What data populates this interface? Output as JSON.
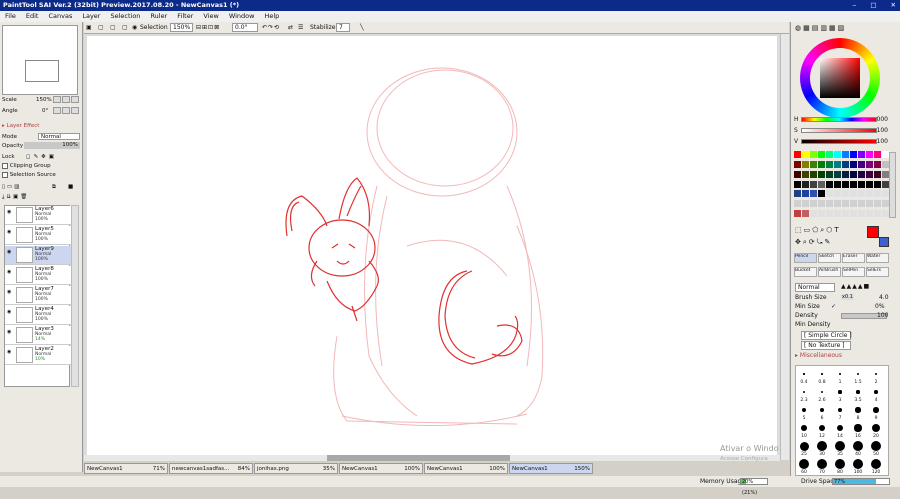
{
  "title": "PaintTool SAI Ver.2 (32bit) Preview.2017.08.20 - NewCanvas1 (*)",
  "menu": [
    "File",
    "Edit",
    "Canvas",
    "Layer",
    "Selection",
    "Ruler",
    "Filter",
    "View",
    "Window",
    "Help"
  ],
  "nav": {
    "scale_label": "Scale",
    "scale_value": "150%",
    "angle_label": "Angle",
    "angle_value": "0°"
  },
  "layer_effect": {
    "header": "Layer Effect",
    "mode_label": "Mode",
    "mode_value": "Normal",
    "opacity_label": "Opacity",
    "opacity_value": "100%",
    "lock_label": "Lock",
    "clipping": "Clipping Group",
    "selection_source": "Selection Source"
  },
  "layers": [
    {
      "name": "Layer6",
      "mode": "Normal",
      "opacity": "100%",
      "selected": false
    },
    {
      "name": "Layer5",
      "mode": "Normal",
      "opacity": "100%",
      "selected": false
    },
    {
      "name": "Layer9",
      "mode": "Normal",
      "opacity": "100%",
      "selected": true
    },
    {
      "name": "Layer8",
      "mode": "Normal",
      "opacity": "100%",
      "selected": false
    },
    {
      "name": "Layer7",
      "mode": "Normal",
      "opacity": "100%",
      "selected": false
    },
    {
      "name": "Layer4",
      "mode": "Normal",
      "opacity": "100%",
      "selected": false
    },
    {
      "name": "Layer3",
      "mode": "Normal",
      "opacity": "14%",
      "selected": false
    },
    {
      "name": "Layer2",
      "mode": "Normal",
      "opacity": "10%",
      "selected": false
    }
  ],
  "toolbar": {
    "selection_label": "Selection",
    "zoom": "150%",
    "angle": "0.0°",
    "stabilizer_label": "Stabilizer",
    "stabilizer_value": "7"
  },
  "tabs": [
    {
      "name": "NewCanvas1",
      "pct": "71%",
      "active": false
    },
    {
      "name": "newcanvas1sadfas...",
      "pct": "84%",
      "active": false
    },
    {
      "name": "jonihas.png",
      "pct": "35%",
      "active": false
    },
    {
      "name": "NewCanvas1",
      "pct": "100%",
      "active": false
    },
    {
      "name": "NewCanvas1",
      "pct": "100%",
      "active": false
    },
    {
      "name": "NewCanvas1",
      "pct": "150%",
      "active": true
    }
  ],
  "status": {
    "memory_label": "Memory Usage",
    "memory_value": "20% (21%)",
    "memory_fill": 0.2,
    "drive_label": "Drive Space",
    "drive_value": "77%",
    "drive_fill": 0.77
  },
  "color": {
    "h_label": "H",
    "h_value": "000",
    "s_label": "S",
    "s_value": "100",
    "v_label": "V",
    "v_value": "100",
    "main": "#ff0000",
    "secondary": "#4060d0"
  },
  "tools": {
    "row1": [
      "Pencil",
      "Sketch",
      "Eraser",
      "Water"
    ],
    "row2": [
      "Bucket",
      "AirBrush",
      "SelPen",
      "SelErs"
    ]
  },
  "brush": {
    "mode": "Normal",
    "size_label": "Brush Size",
    "size_mult": "x0.1",
    "size_value": "4.0",
    "minsize_label": "Min Size",
    "minsize_value": "0%",
    "density_label": "Density",
    "density_value": "100",
    "mindensity_label": "Min Density",
    "shape": "[ Simple Circle ]",
    "texture": "[ No Texture ]",
    "misc": "Miscellaneous"
  },
  "brush_sizes": [
    "0.4",
    "0.8",
    "1",
    "1.5",
    "2",
    "2.3",
    "2.6",
    "3",
    "3.5",
    "4",
    "5",
    "6",
    "7",
    "8",
    "9",
    "10",
    "12",
    "14",
    "16",
    "20",
    "25",
    "30",
    "35",
    "40",
    "50",
    "60",
    "70",
    "80",
    "100",
    "120"
  ],
  "watermark": {
    "line1": "Ativar o Windo",
    "line2": "Acesse Configura"
  }
}
